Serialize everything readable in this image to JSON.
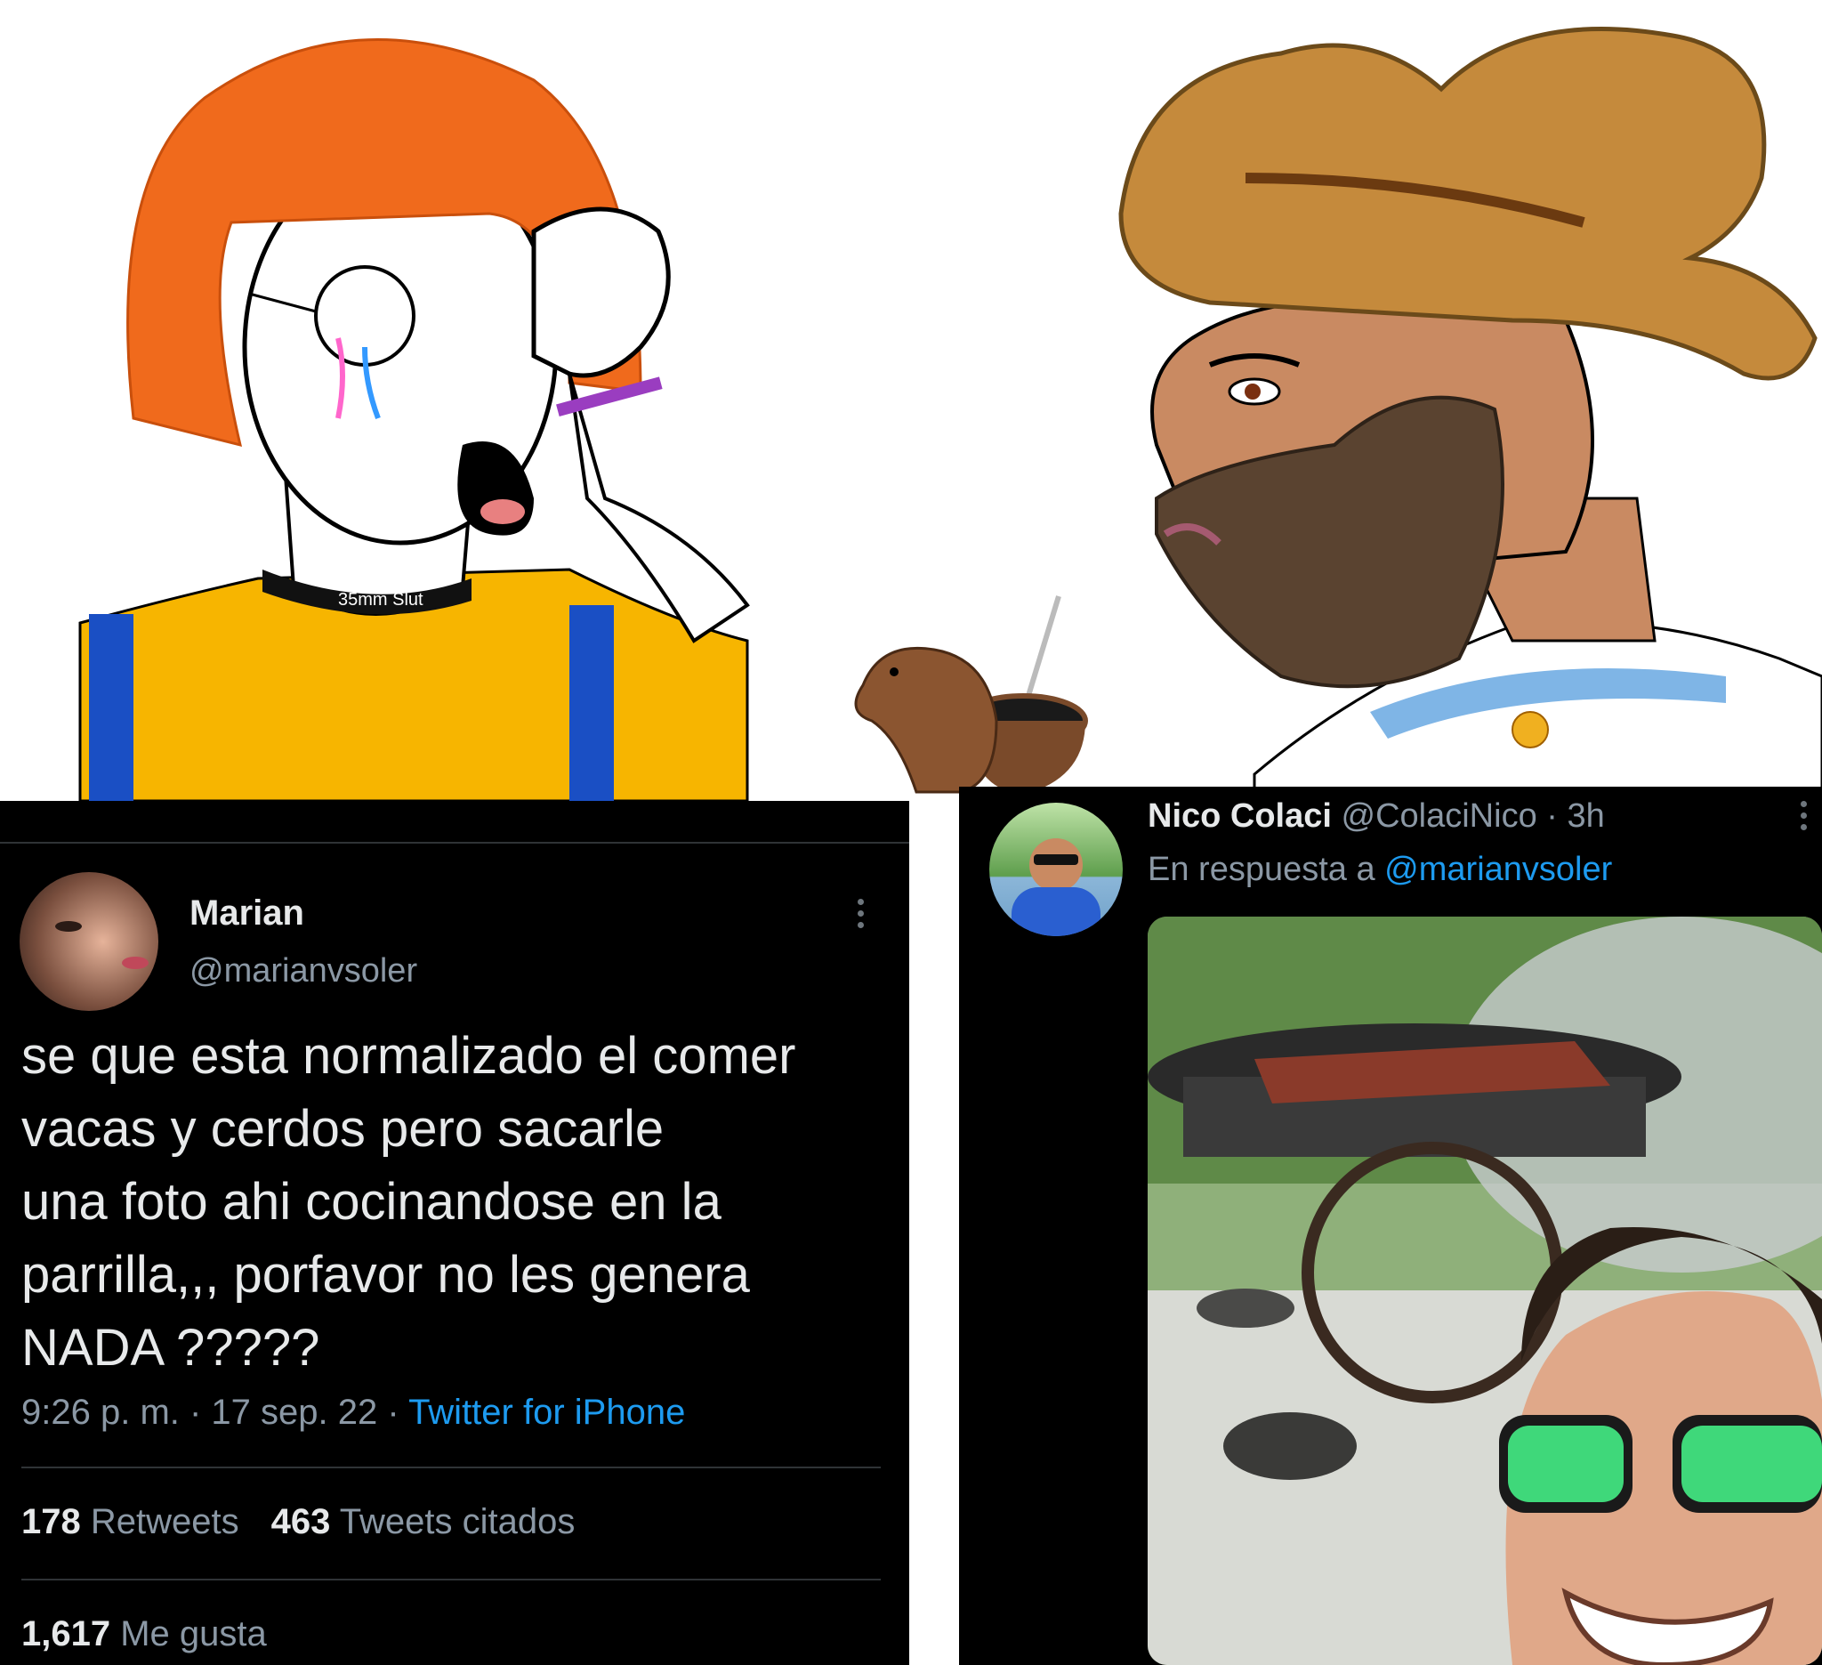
{
  "cartoon_left": {
    "choker_text": "35mm Slut"
  },
  "tweet_original": {
    "name": "Marian",
    "handle": "@marianvsoler",
    "text_lines": [
      "se que esta normalizado el comer",
      "vacas y cerdos pero sacarle",
      "una foto ahi cocinandose en la",
      "parrilla,,, porfavor no les genera",
      "NADA ?????"
    ],
    "time": "9:26 p. m. · 17 sep. 22 · ",
    "source": "Twitter for iPhone",
    "retweets_count": "178",
    "retweets_label": " Retweets",
    "quotes_count": "463",
    "quotes_label": " Tweets citados",
    "likes_count": "1,617",
    "likes_label": " Me gusta"
  },
  "tweet_reply": {
    "name": "Nico Colaci",
    "handle_time": " @ColaciNico · 3h",
    "reply_prefix": "En respuesta a ",
    "reply_to": "@marianvsoler"
  },
  "colors": {
    "link": "#1d9bf0",
    "background": "#000000",
    "muted": "#8b98a5"
  }
}
